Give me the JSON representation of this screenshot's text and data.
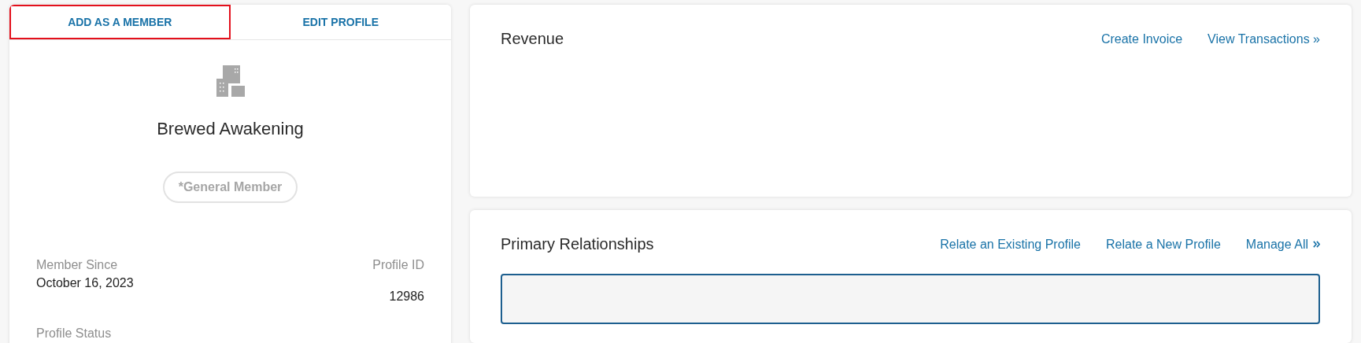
{
  "profile_card": {
    "tabs": [
      {
        "label": "ADD AS A MEMBER",
        "outlined": true
      },
      {
        "label": "EDIT PROFILE",
        "outlined": false
      }
    ],
    "name": "Brewed Awakening",
    "badge": "*General Member",
    "fields": [
      {
        "label": "Member Since",
        "value": "October 16, 2023"
      },
      {
        "label": "Profile ID",
        "value": "12986"
      },
      {
        "label": "Profile Status"
      }
    ]
  },
  "revenue": {
    "title": "Revenue",
    "links": [
      {
        "label": "Create Invoice"
      },
      {
        "label": "View Transactions »"
      }
    ]
  },
  "relationships": {
    "title": "Primary Relationships",
    "links": [
      {
        "label": "Relate an Existing Profile"
      },
      {
        "label": "Relate a New Profile"
      },
      {
        "label": "Manage All",
        "kind": "expand"
      }
    ]
  }
}
